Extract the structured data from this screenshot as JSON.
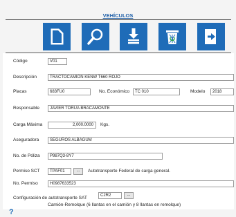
{
  "header": {
    "title": "VEHÍCULOS"
  },
  "toolbar": {
    "new": "new-document-icon",
    "search": "search-icon",
    "save": "save-icon",
    "delete": "recycle-bin-icon",
    "exit": "exit-icon",
    "accent": "#1f6cb8"
  },
  "form": {
    "codigo": {
      "label": "Código",
      "value": "V01"
    },
    "descripcion": {
      "label": "Descripción",
      "value": "TRACTOCAMIÓN KENW T660 ROJO"
    },
    "placas": {
      "label": "Placas",
      "value": "683FU0"
    },
    "no_economico": {
      "label": "No. Económico",
      "value": "TC 010"
    },
    "modelo": {
      "label": "Modelo",
      "value": "2018"
    },
    "responsable": {
      "label": "Responsable",
      "value": "JAVIER TORUA BRACAMONTE"
    },
    "carga_maxima": {
      "label": "Carga Máxima",
      "value": "2,000.0000",
      "unit": "Kgs."
    },
    "aseguradora": {
      "label": "Aseguradora",
      "value": "SEGUROS ALBAGUM"
    },
    "no_poliza": {
      "label": "No. de Póliza",
      "value": "P987Q3-8Y7"
    },
    "permiso_sct": {
      "label": "Permiso SCT",
      "value": "TPAF01",
      "button": "...",
      "description": "Autotransporte Federal de carga general."
    },
    "no_permiso": {
      "label": "No. Permiso",
      "value": "H0987633523"
    },
    "config_sat": {
      "label": "Configuración de autotransporte SAT",
      "value": "C2R2",
      "button": "...",
      "description": "Camión-Remolque (6 llantas en el camión y 8 llantas en remolque)"
    }
  },
  "help": {
    "label": "?"
  }
}
